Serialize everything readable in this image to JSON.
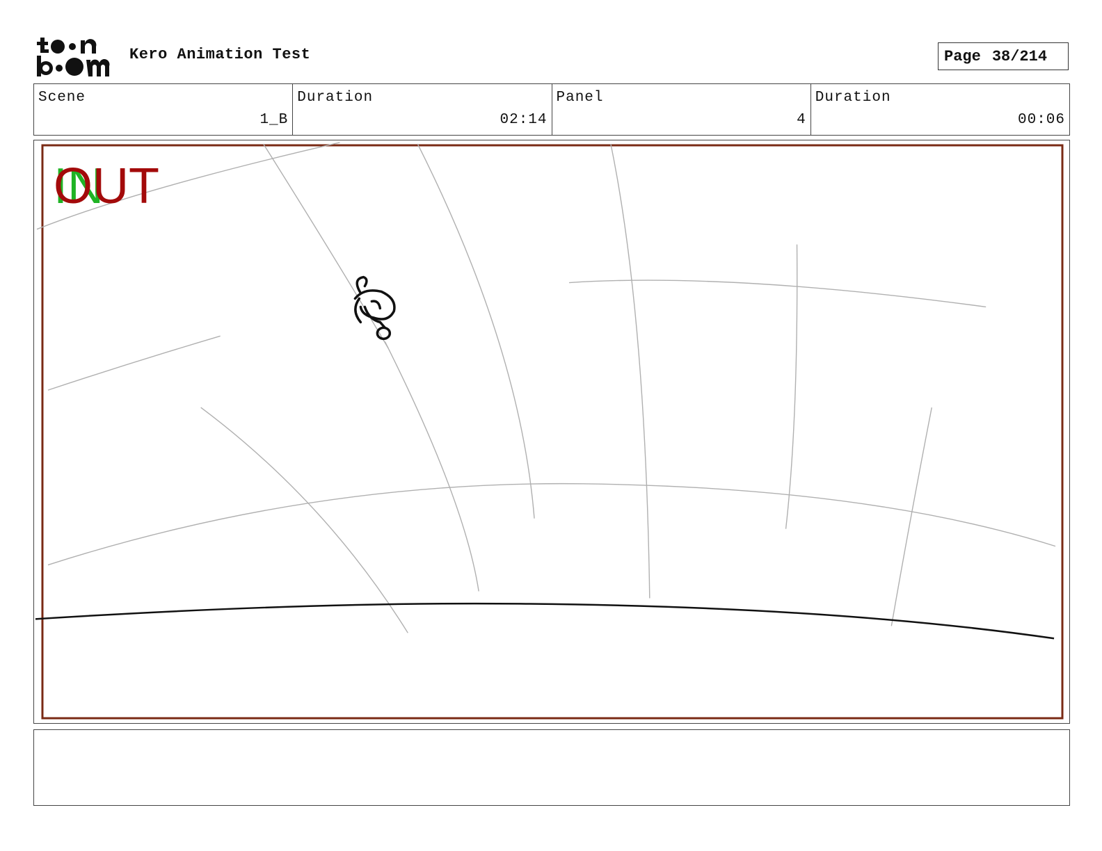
{
  "header": {
    "project_title": "Kero Animation Test",
    "page_label": "Page",
    "page_value": "38/214"
  },
  "logo": {
    "name": "toonboom-logo",
    "text_top": "toon",
    "text_bottom": "boom"
  },
  "info": {
    "scene_label": "Scene",
    "scene_value": "1_B",
    "scene_duration_label": "Duration",
    "scene_duration_value": "02:14",
    "panel_label": "Panel",
    "panel_value": "4",
    "panel_duration_label": "Duration",
    "panel_duration_value": "00:06"
  },
  "panel": {
    "in_marker": "IN",
    "out_marker": "OUT",
    "frame_color": "#7a2a14",
    "in_color": "#1fb324",
    "out_color": "#a30a0a"
  },
  "notes": {
    "text": ""
  }
}
